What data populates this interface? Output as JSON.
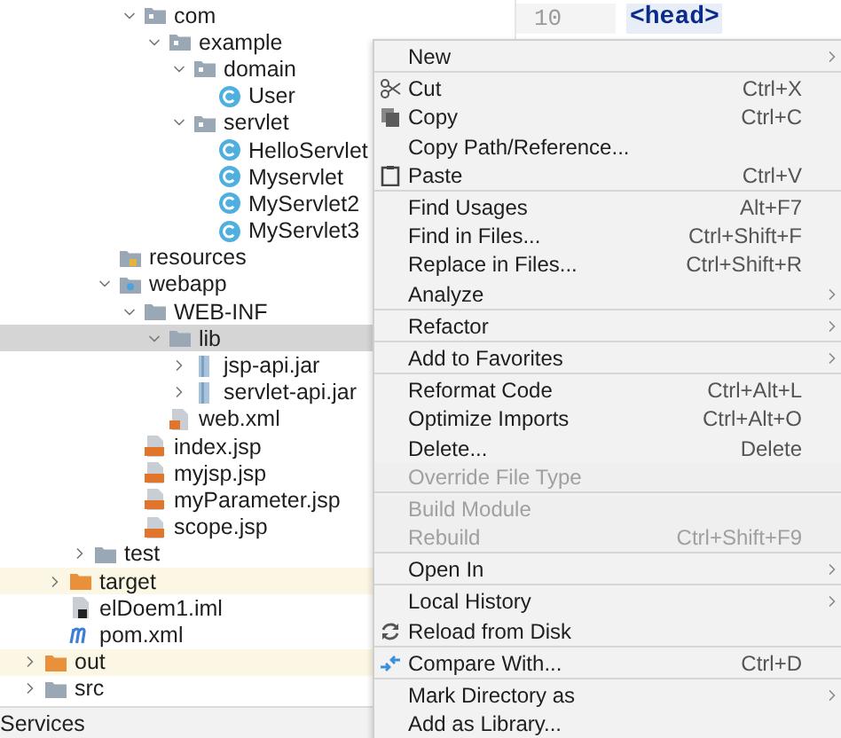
{
  "project_tree": {
    "children": [
      {
        "children": [
          {
            "children": [
              {
                "children": [
                  {
                    "children": [
                      {
                        "label": "com",
                        "kind": "package",
                        "expanded": true,
                        "selected": false,
                        "children": [
                          {
                            "label": "example",
                            "kind": "package",
                            "expanded": true,
                            "selected": false,
                            "children": [
                              {
                                "label": "domain",
                                "kind": "package",
                                "expanded": true,
                                "selected": false,
                                "children": [
                                  {
                                    "label": "User",
                                    "kind": "class",
                                    "selected": false
                                  }
                                ]
                              },
                              {
                                "label": "servlet",
                                "kind": "package",
                                "expanded": true,
                                "selected": false,
                                "children": [
                                  {
                                    "label": "HelloServlet",
                                    "kind": "class",
                                    "selected": false
                                  },
                                  {
                                    "label": "Myservlet",
                                    "kind": "class",
                                    "selected": false
                                  },
                                  {
                                    "label": "MyServlet2",
                                    "kind": "class",
                                    "selected": false
                                  },
                                  {
                                    "label": "MyServlet3",
                                    "kind": "class",
                                    "selected": false
                                  }
                                ]
                              }
                            ]
                          }
                        ]
                      }
                    ]
                  },
                  {
                    "label": "resources",
                    "kind": "resources",
                    "selected": false
                  },
                  {
                    "label": "webapp",
                    "kind": "web",
                    "expanded": true,
                    "selected": false,
                    "children": [
                      {
                        "label": "WEB-INF",
                        "kind": "folder",
                        "expanded": true,
                        "selected": false,
                        "children": [
                          {
                            "label": "lib",
                            "kind": "folder",
                            "expanded": true,
                            "selected": true,
                            "children": [
                              {
                                "label": "jsp-api.jar",
                                "kind": "jar",
                                "expanded": false,
                                "selected": false
                              },
                              {
                                "label": "servlet-api.jar",
                                "kind": "jar",
                                "expanded": false,
                                "selected": false
                              }
                            ]
                          },
                          {
                            "label": "web.xml",
                            "kind": "xml",
                            "selected": false
                          }
                        ]
                      },
                      {
                        "label": "index.jsp",
                        "kind": "jsp",
                        "selected": false
                      },
                      {
                        "label": "myjsp.jsp",
                        "kind": "jsp",
                        "selected": false
                      },
                      {
                        "label": "myParameter.jsp",
                        "kind": "jsp",
                        "selected": false
                      },
                      {
                        "label": "scope.jsp",
                        "kind": "jsp",
                        "selected": false
                      }
                    ]
                  }
                ]
              },
              {
                "label": "test",
                "kind": "folder",
                "expanded": false,
                "selected": false
              }
            ]
          },
          {
            "label": "target",
            "kind": "excluded",
            "expanded": false,
            "selected": false
          },
          {
            "label": "elDoem1.iml",
            "kind": "iml",
            "selected": false
          },
          {
            "label": "pom.xml",
            "kind": "maven",
            "selected": false
          }
        ]
      },
      {
        "label": "out",
        "kind": "excluded",
        "expanded": false,
        "selected": false
      },
      {
        "label": "src",
        "kind": "folder",
        "expanded": false,
        "selected": false
      }
    ]
  },
  "editor": {
    "line_number": "10",
    "code": "<head>"
  },
  "context_menu": {
    "groups": [
      [
        {
          "label": "New",
          "submenu": true
        }
      ],
      [
        {
          "label": "Cut",
          "kind": "cut",
          "shortcut": "Ctrl+X",
          "submenu": false
        },
        {
          "label": "Copy",
          "kind": "copy",
          "shortcut": "Ctrl+C",
          "submenu": false
        },
        {
          "label": "Copy Path/Reference...",
          "submenu": false
        },
        {
          "label": "Paste",
          "kind": "paste",
          "shortcut": "Ctrl+V",
          "submenu": false
        }
      ],
      [
        {
          "label": "Find Usages",
          "shortcut": "Alt+F7",
          "submenu": false
        },
        {
          "label": "Find in Files...",
          "shortcut": "Ctrl+Shift+F",
          "submenu": false
        },
        {
          "label": "Replace in Files...",
          "shortcut": "Ctrl+Shift+R",
          "submenu": false
        },
        {
          "label": "Analyze",
          "submenu": true
        }
      ],
      [
        {
          "label": "Refactor",
          "submenu": true
        }
      ],
      [
        {
          "label": "Add to Favorites",
          "submenu": true
        }
      ],
      [
        {
          "label": "Reformat Code",
          "shortcut": "Ctrl+Alt+L",
          "submenu": false,
          "disabled": false
        },
        {
          "label": "Optimize Imports",
          "shortcut": "Ctrl+Alt+O",
          "submenu": false,
          "disabled": false
        },
        {
          "label": "Delete...",
          "shortcut": "Delete",
          "submenu": false,
          "disabled": false
        },
        {
          "label": "Override File Type",
          "submenu": false,
          "disabled": true
        }
      ],
      [
        {
          "label": "Build Module",
          "submenu": false,
          "disabled": true
        },
        {
          "label": "Rebuild",
          "shortcut": "Ctrl+Shift+F9",
          "submenu": false,
          "disabled": true
        }
      ],
      [
        {
          "label": "Open In",
          "submenu": true
        }
      ],
      [
        {
          "label": "Local History",
          "submenu": true
        },
        {
          "label": "Reload from Disk",
          "kind": "reload",
          "submenu": false
        }
      ],
      [
        {
          "label": "Compare With...",
          "kind": "compare",
          "shortcut": "Ctrl+D",
          "submenu": false
        }
      ],
      [
        {
          "label": "Mark Directory as",
          "submenu": true
        },
        {
          "label": "Add as Library...",
          "submenu": false
        }
      ]
    ]
  },
  "bottom_bar": {
    "tab": "Services"
  }
}
